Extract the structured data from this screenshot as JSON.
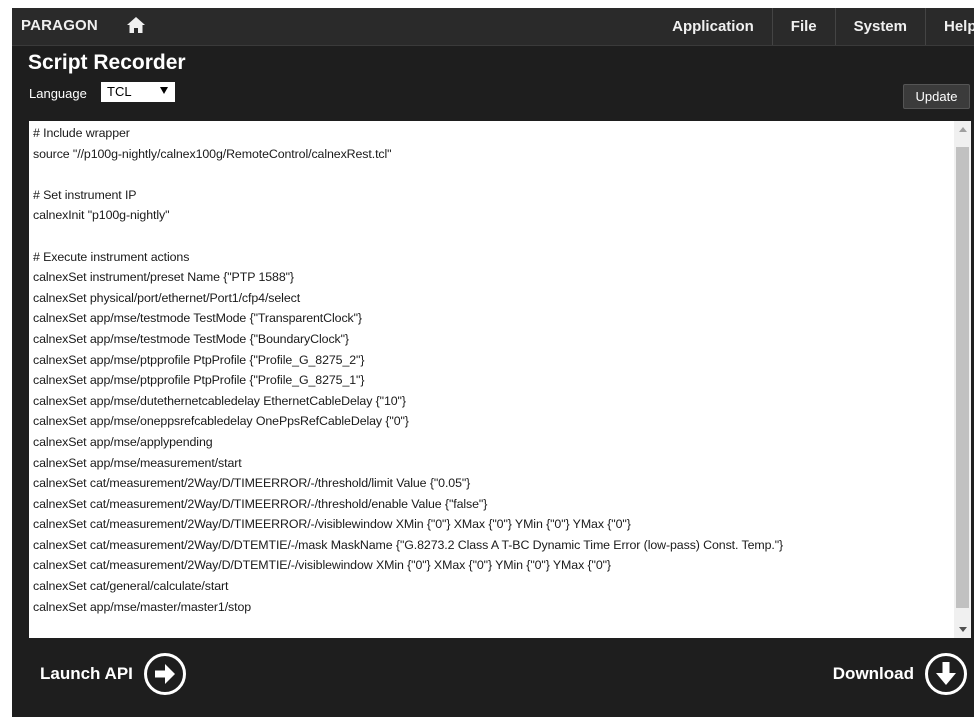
{
  "header": {
    "brand": "PARAGON",
    "menu": [
      "Application",
      "File",
      "System",
      "Help"
    ]
  },
  "page": {
    "title": "Script Recorder",
    "language_label": "Language",
    "language_value": "TCL",
    "update_label": "Update"
  },
  "script": {
    "lines": [
      "# Include wrapper",
      "source \"//p100g-nightly/calnex100g/RemoteControl/calnexRest.tcl\"",
      "",
      "# Set instrument IP",
      "calnexInit \"p100g-nightly\"",
      "",
      "# Execute instrument actions",
      "calnexSet instrument/preset Name {\"PTP 1588\"}",
      "calnexSet physical/port/ethernet/Port1/cfp4/select",
      "calnexSet app/mse/testmode TestMode {\"TransparentClock\"}",
      "calnexSet app/mse/testmode TestMode {\"BoundaryClock\"}",
      "calnexSet app/mse/ptpprofile PtpProfile {\"Profile_G_8275_2\"}",
      "calnexSet app/mse/ptpprofile PtpProfile {\"Profile_G_8275_1\"}",
      "calnexSet app/mse/dutethernetcabledelay EthernetCableDelay {\"10\"}",
      "calnexSet app/mse/oneppsrefcabledelay OnePpsRefCableDelay {\"0\"}",
      "calnexSet app/mse/applypending",
      "calnexSet app/mse/measurement/start",
      "calnexSet cat/measurement/2Way/D/TIMEERROR/-/threshold/limit Value {\"0.05\"}",
      "calnexSet cat/measurement/2Way/D/TIMEERROR/-/threshold/enable Value {\"false\"}",
      "calnexSet cat/measurement/2Way/D/TIMEERROR/-/visiblewindow XMin {\"0\"} XMax {\"0\"} YMin {\"0\"} YMax {\"0\"}",
      "calnexSet cat/measurement/2Way/D/DTEMTIE/-/mask MaskName {\"G.8273.2 Class A T-BC Dynamic Time Error (low-pass) Const. Temp.\"}",
      "calnexSet cat/measurement/2Way/D/DTEMTIE/-/visiblewindow XMin {\"0\"} XMax {\"0\"} YMin {\"0\"} YMax {\"0\"}",
      "calnexSet cat/general/calculate/start",
      "calnexSet app/mse/master/master1/stop"
    ]
  },
  "footer": {
    "launch_label": "Launch API",
    "download_label": "Download"
  }
}
